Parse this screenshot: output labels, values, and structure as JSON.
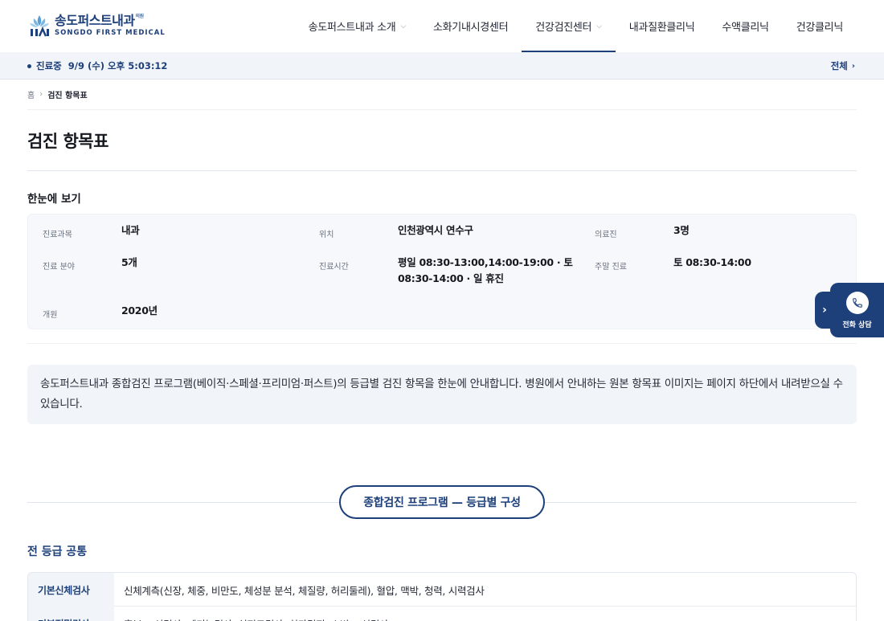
{
  "brand": {
    "name_ko": "송도퍼스트내과",
    "sup": "의원",
    "name_en": "SONGDO FIRST MEDICAL"
  },
  "nav": {
    "items": [
      {
        "label": "송도퍼스트내과 소개",
        "dropdown": true,
        "active": false
      },
      {
        "label": "소화기내시경센터",
        "dropdown": false,
        "active": false
      },
      {
        "label": "건강검진센터",
        "dropdown": true,
        "active": true
      },
      {
        "label": "내과질환클리닉",
        "dropdown": false,
        "active": false
      },
      {
        "label": "수액클리닉",
        "dropdown": false,
        "active": false
      },
      {
        "label": "건강클리닉",
        "dropdown": false,
        "active": false
      }
    ]
  },
  "status": {
    "state": "진료중",
    "datetime": "9/9 (수) 오후 5:03:12",
    "all_link": "전체"
  },
  "breadcrumb": {
    "home": "홈",
    "current": "검진 항목표"
  },
  "page": {
    "title": "검진 항목표",
    "overview_heading": "한눈에 보기"
  },
  "info": {
    "dept_label": "진료과목",
    "dept_value": "내과",
    "loc_label": "위치",
    "loc_value": "인천광역시 연수구",
    "staff_label": "의료진",
    "staff_value": "3명",
    "field_label": "진료 분야",
    "field_value": "5개",
    "hours_label": "진료시간",
    "hours_value_1": "평일 08:30-13:00,14:00-19:00 · 토",
    "hours_value_2": "08:30-14:00 · 일 휴진",
    "weekend_label": "주말 진료",
    "weekend_value": "토 08:30-14:00",
    "open_label": "개원",
    "open_value": "2020년"
  },
  "intro": {
    "text": "송도퍼스트내과 종합검진 프로그램(베이직·스페셜·프리미엄·퍼스트)의 등급별 검진 항목을 한눈에 안내합니다. 병원에서 안내하는 원본 항목표 이미지는 페이지 하단에서 내려받으실 수 있습니다."
  },
  "program": {
    "pill": "종합검진 프로그램 — 등급별 구성",
    "common_heading": "전 등급 공통"
  },
  "table": {
    "rows": [
      {
        "header": "기본신체검사",
        "value": "신체계측(신장, 체중, 비만도, 체성분 분석, 체질량, 허리둘레), 혈압, 맥박, 청력, 시력검사"
      },
      {
        "header": "기본정밀검사",
        "value": "흉부 X-선검사, 폐기능검사, 심전도검사, 치과검진, 소변 X-선검사"
      }
    ]
  },
  "floating": {
    "call_label": "전화 상담"
  },
  "colors": {
    "brand": "#1d3f7a",
    "status_bg": "#f1f4f9"
  }
}
